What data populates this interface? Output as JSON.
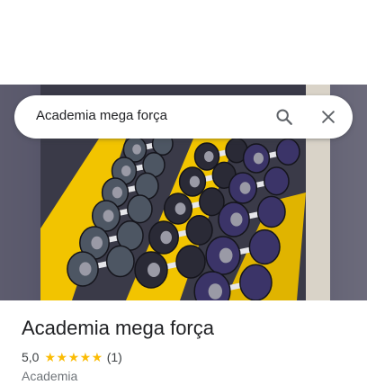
{
  "search": {
    "value": "Academia mega força",
    "search_icon": "search-icon",
    "close_icon": "close-icon"
  },
  "place": {
    "name": "Academia mega força",
    "rating": "5,0",
    "stars_value": 5,
    "stars_display": "★★★★★",
    "review_count": "(1)",
    "category": "Academia"
  },
  "photo": {
    "subject": "dumbbell rack",
    "colors": {
      "frame": "#f2c400",
      "plates_dark": "#2a2a36",
      "plates_steel": "#4d5663",
      "plates_purple": "#3b3468",
      "chrome": "#e6e6ea",
      "wall": "#d9d3c8"
    }
  },
  "colors": {
    "text_primary": "#202124",
    "text_secondary": "#70757a",
    "star": "#fbbc04",
    "icon": "#5f6368"
  }
}
